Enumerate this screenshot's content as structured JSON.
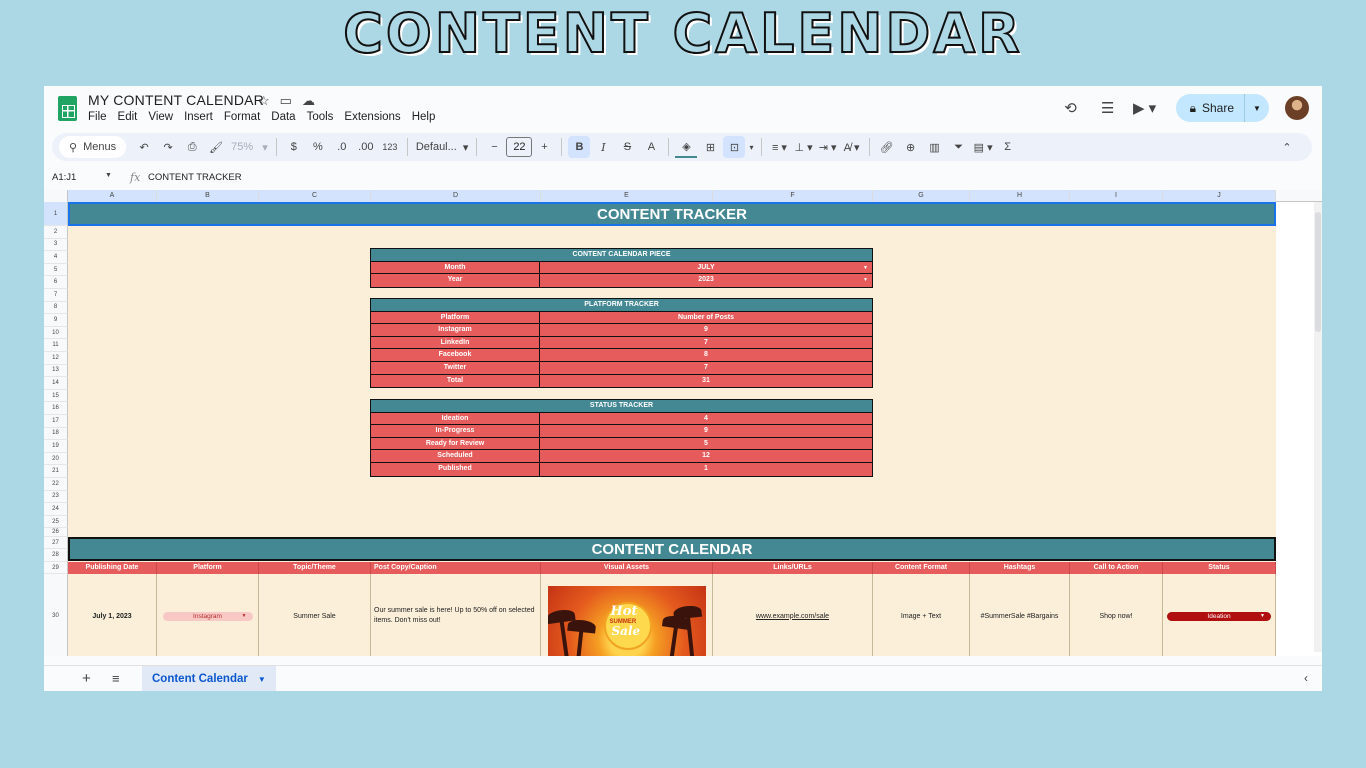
{
  "banner": "CONTENT CALENDAR",
  "app": {
    "title": "MY CONTENT CALENDAR",
    "menu": [
      "File",
      "Edit",
      "View",
      "Insert",
      "Format",
      "Data",
      "Tools",
      "Extensions",
      "Help"
    ],
    "share_label": "Share"
  },
  "toolbar": {
    "search_label": "Menus",
    "zoom": "75%",
    "currency": "$",
    "percent": "%",
    "dec_less": ".0",
    "dec_more": ".00",
    "number_format": "123",
    "font": "Defaul...",
    "font_size": "22",
    "bold": "B",
    "italic": "I",
    "strike": "S",
    "text_color": "A",
    "sigma": "Σ"
  },
  "formula_bar": {
    "name_box": "A1:J1",
    "fx": "fx",
    "value": "CONTENT TRACKER"
  },
  "columns": [
    "A",
    "B",
    "C",
    "D",
    "E",
    "F",
    "G",
    "H",
    "I",
    "J"
  ],
  "rows": [
    "1",
    "2",
    "3",
    "4",
    "5",
    "6",
    "7",
    "8",
    "9",
    "10",
    "11",
    "12",
    "13",
    "14",
    "15",
    "16",
    "17",
    "18",
    "19",
    "20",
    "21",
    "22",
    "23",
    "24",
    "25",
    "26",
    "27",
    "28",
    "29",
    "30"
  ],
  "tracker": {
    "title": "CONTENT TRACKER",
    "piece": {
      "header": "CONTENT CALENDAR PIECE",
      "rows": [
        {
          "label": "Month",
          "value": "JULY"
        },
        {
          "label": "Year",
          "value": "2023"
        }
      ]
    },
    "platform": {
      "header": "PLATFORM TRACKER",
      "rows": [
        {
          "label": "Platform",
          "value": "Number of Posts"
        },
        {
          "label": "Instagram",
          "value": "9"
        },
        {
          "label": "LinkedIn",
          "value": "7"
        },
        {
          "label": "Facebook",
          "value": "8"
        },
        {
          "label": "Twitter",
          "value": "7"
        },
        {
          "label": "Total",
          "value": "31"
        }
      ]
    },
    "status": {
      "header": "STATUS TRACKER",
      "rows": [
        {
          "label": "Ideation",
          "value": "4"
        },
        {
          "label": "In-Progress",
          "value": "9"
        },
        {
          "label": "Ready for Review",
          "value": "5"
        },
        {
          "label": "Scheduled",
          "value": "12"
        },
        {
          "label": "Published",
          "value": "1"
        }
      ]
    }
  },
  "calendar": {
    "title": "CONTENT CALENDAR",
    "headers": [
      "Publishing Date",
      "Platform",
      "Topic/Theme",
      "Post Copy/Caption",
      "Visual Assets",
      "Links/URLs",
      "Content Format",
      "Hashtags",
      "Call to Action",
      "Status"
    ],
    "row": {
      "date": "July 1, 2023",
      "platform": "Instagram",
      "topic": "Summer Sale",
      "copy": "Our summer sale is here! Up to 50% off on selected items. Don't miss out!",
      "visual": {
        "hot": "Hot",
        "summer": "SUMMER",
        "sale": "Sale"
      },
      "link": "www.example.com/sale",
      "format": "Image + Text",
      "hashtags": "#SummerSale #Bargains",
      "cta": "Shop now!",
      "status": "Ideation"
    }
  },
  "sheet_tab": "Content Calendar",
  "colors": {
    "teal": "#448894",
    "coral": "#e65b5b",
    "cream": "#fbefd9",
    "status_red": "#b10f0f"
  }
}
